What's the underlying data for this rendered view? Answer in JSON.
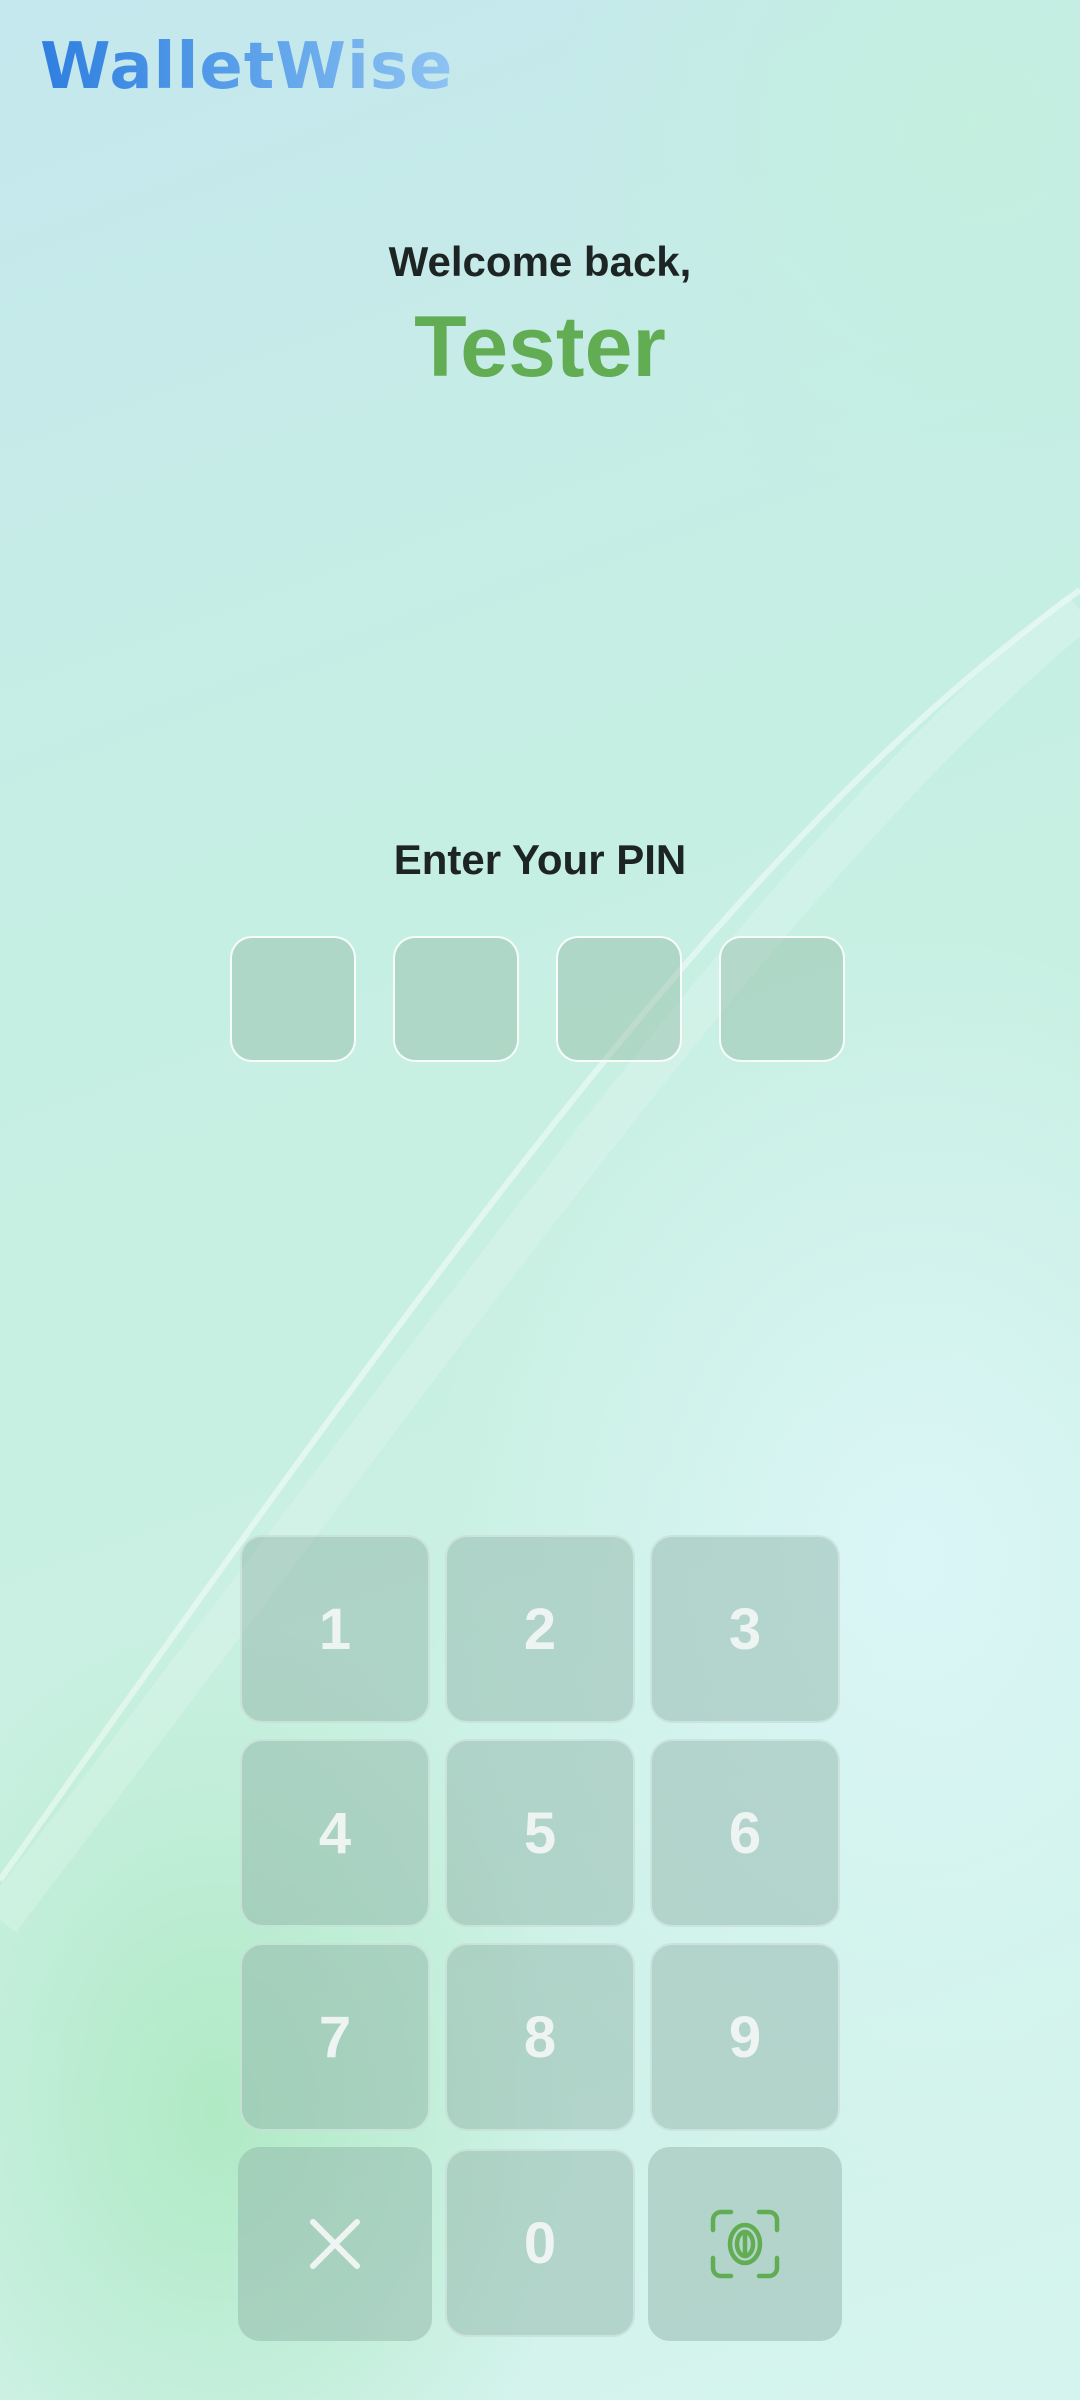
{
  "app": {
    "logo_text": "WalletWise",
    "accent_color": "#62ad53",
    "logo_color": "#3f8be0"
  },
  "greeting": {
    "welcome": "Welcome back,",
    "username": "Tester"
  },
  "pin": {
    "title": "Enter Your PIN",
    "digits_entered": 0,
    "length": 4
  },
  "keypad": {
    "keys": [
      "1",
      "2",
      "3",
      "4",
      "5",
      "6",
      "7",
      "8",
      "9",
      "0"
    ],
    "clear_icon": "close-icon",
    "biometric_icon": "fingerprint-scan-icon"
  }
}
